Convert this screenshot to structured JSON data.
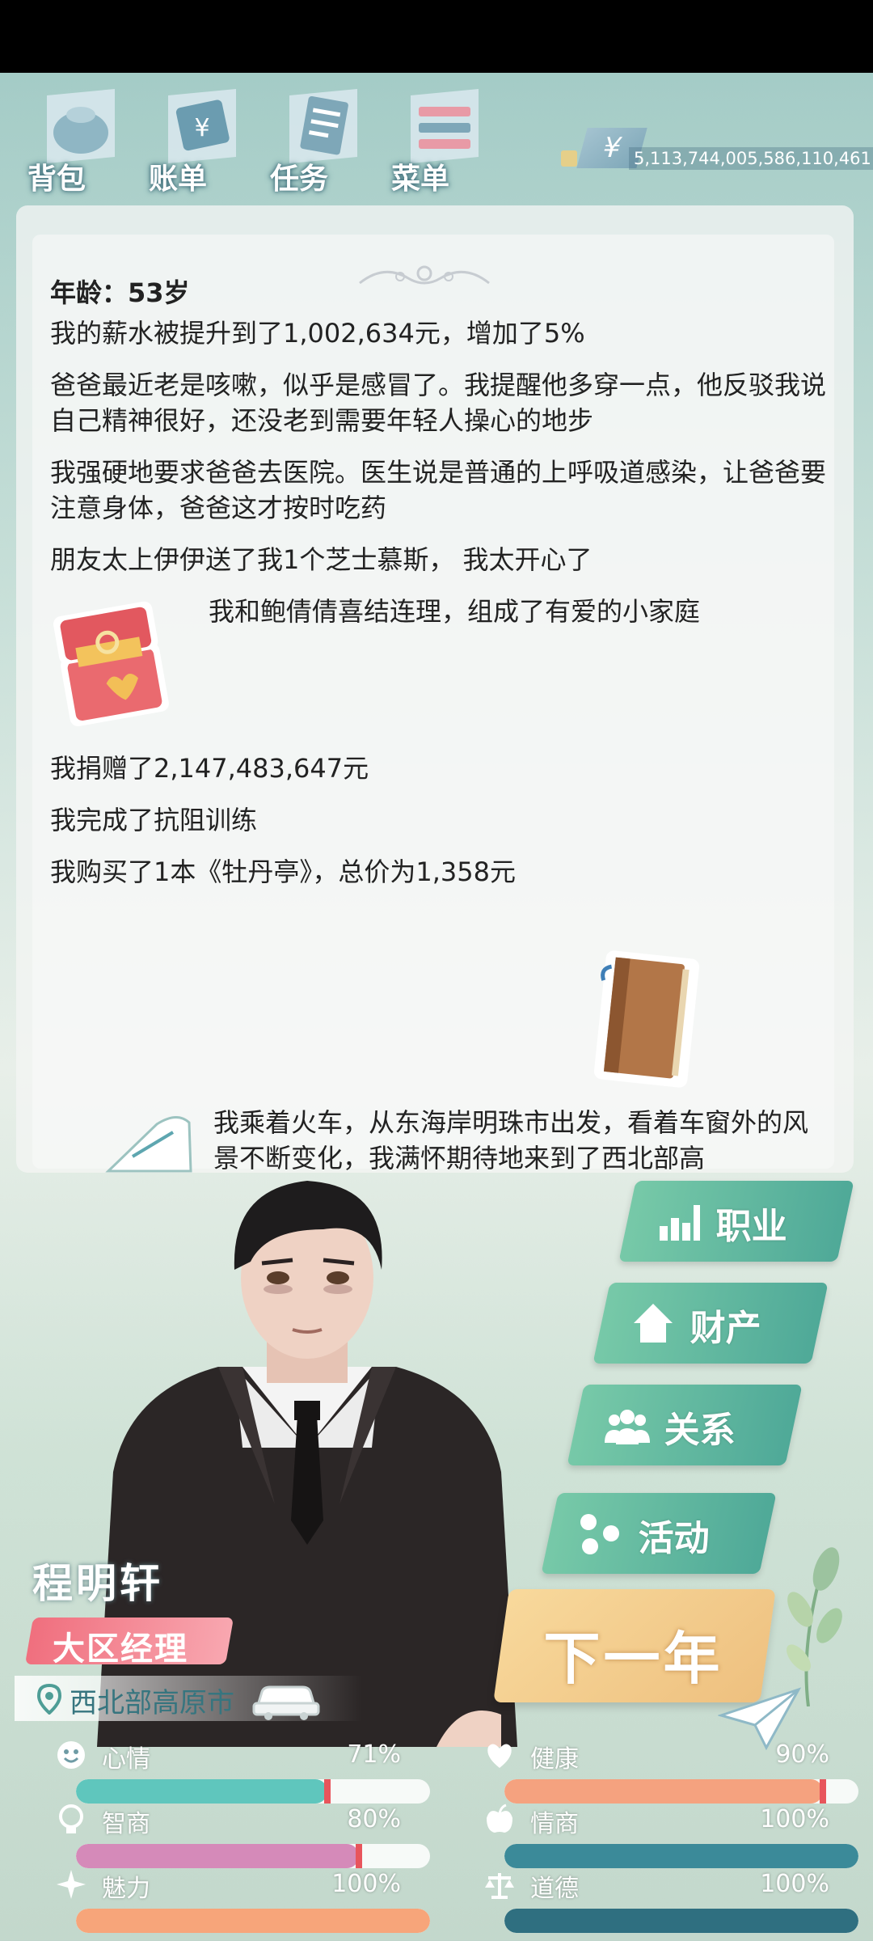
{
  "menu": [
    {
      "label": "背包",
      "icon": "bag-icon"
    },
    {
      "label": "账单",
      "icon": "bill-icon"
    },
    {
      "label": "任务",
      "icon": "task-icon"
    },
    {
      "label": "菜单",
      "icon": "menu-icon"
    }
  ],
  "money": {
    "symbol": "¥",
    "value": "5,113,744,005,586,110,461"
  },
  "log": {
    "age": "年龄：53岁",
    "entries": [
      "我的薪水被提升到了1,002,634元，增加了5%",
      "爸爸最近老是咳嗽，似乎是感冒了。我提醒他多穿一点，他反驳我说自己精神很好，还没老到需要年轻人操心的地步",
      "我强硬地要求爸爸去医院。医生说是普通的上呼吸道感染，让爸爸要注意身体，爸爸这才按时吃药",
      "朋友太上伊伊送了我1个芝士慕斯， 我太开心了",
      "我和鲍倩倩喜结连理，组成了有爱的小家庭",
      "我捐赠了2,147,483,647元",
      "我完成了抗阻训练",
      "我购买了1本《牡丹亭》，总价为1,358元",
      "我乘着火车，从东海岸明珠市出发，看着车窗外的风景不断变化，我满怀期待地来到了西北部高"
    ]
  },
  "actions": [
    {
      "label": "职业",
      "icon": "career-icon"
    },
    {
      "label": "财产",
      "icon": "house-icon"
    },
    {
      "label": "关系",
      "icon": "people-icon"
    },
    {
      "label": "活动",
      "icon": "activity-icon"
    }
  ],
  "next_year": "下一年",
  "profile": {
    "name": "程明轩",
    "job": "大区经理",
    "location": "西北部高原市"
  },
  "stats": [
    {
      "label": "心情",
      "value": "71%",
      "level": 0.71,
      "color": "#5fc6bd",
      "icon": "smile-icon"
    },
    {
      "label": "健康",
      "value": "90%",
      "level": 0.9,
      "color": "#f5a27f",
      "icon": "heart-icon"
    },
    {
      "label": "智商",
      "value": "80%",
      "level": 0.8,
      "color": "#d58ab9",
      "icon": "bulb-icon"
    },
    {
      "label": "情商",
      "value": "100%",
      "level": 1.0,
      "color": "#3b8a99",
      "icon": "apple-icon"
    },
    {
      "label": "魅力",
      "value": "100%",
      "level": 1.0,
      "color": "#f7a57a",
      "icon": "sparkle-icon"
    },
    {
      "label": "道德",
      "value": "100%",
      "level": 1.0,
      "color": "#2f6f80",
      "icon": "scale-icon"
    }
  ],
  "colors": {
    "accent": "#4fa998",
    "next_year": "#eec07f",
    "job_badge": "#f06f7e"
  }
}
